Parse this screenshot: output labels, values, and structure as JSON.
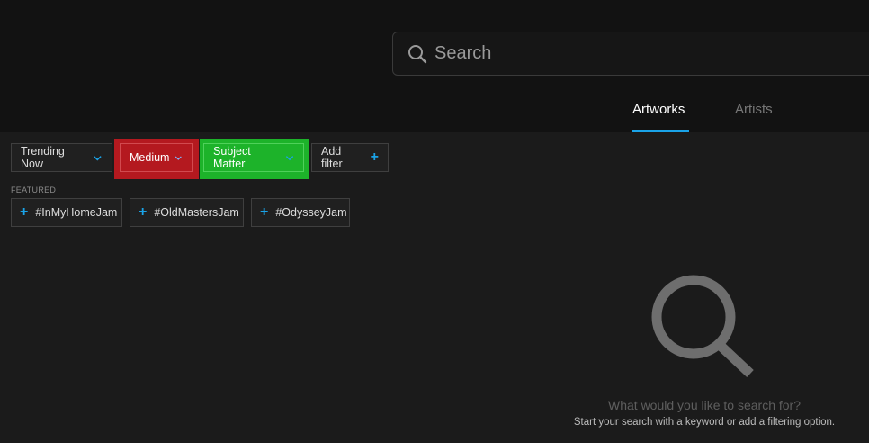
{
  "search": {
    "placeholder": "Search"
  },
  "tabs": [
    {
      "label": "Artworks",
      "active": true
    },
    {
      "label": "Artists",
      "active": false
    }
  ],
  "filters": {
    "trending": "Trending Now",
    "medium": "Medium",
    "subject": "Subject Matter",
    "add": "Add filter"
  },
  "featured": {
    "label": "FEATURED",
    "tags": [
      "#InMyHomeJam",
      "#OldMastersJam",
      "#OdysseyJam"
    ]
  },
  "empty_state": {
    "title": "What would you like to search for?",
    "subtitle": "Start your search with a keyword or add a filtering option."
  },
  "colors": {
    "accent": "#1aa3e8",
    "highlight_red": "#b4191f",
    "highlight_green": "#1db32a",
    "background": "#1b1b1b",
    "header_background": "#121212"
  },
  "icons": [
    "search-icon",
    "chevron-down-icon",
    "plus-icon",
    "magnifier-illustration"
  ]
}
